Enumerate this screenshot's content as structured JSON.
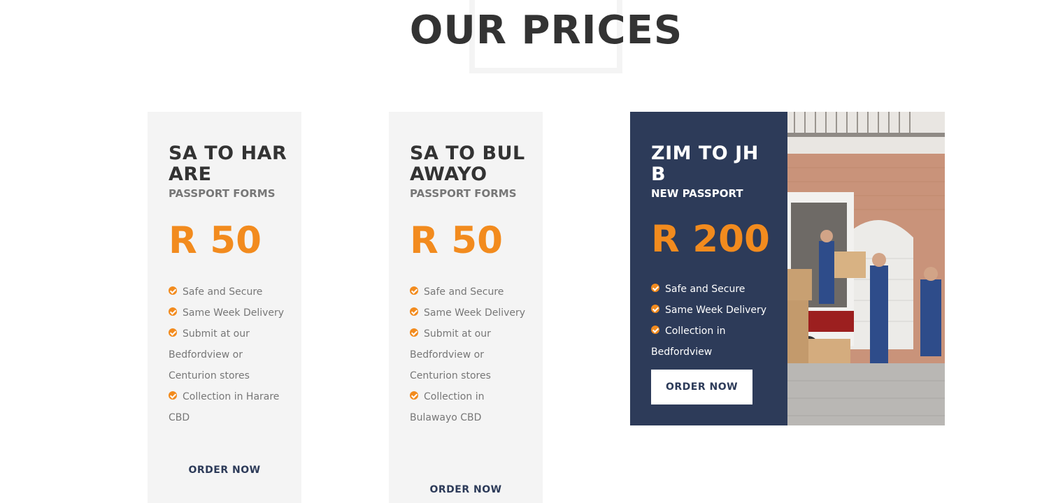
{
  "section": {
    "title": "OUR PRICES"
  },
  "cards": [
    {
      "title": "SA TO HARARE",
      "subtitle": "PASSPORT FORMS",
      "price": "R 50",
      "features": [
        "Safe and Secure",
        "Same Week Delivery",
        "Submit at our Bedfordview or Centurion stores",
        "Collection in Harare CBD"
      ],
      "order_label": "ORDER NOW"
    },
    {
      "title": "SA TO BULAWAYO",
      "subtitle": "PASSPORT FORMS",
      "price": "R 50",
      "features": [
        "Safe and Secure",
        "Same Week Delivery",
        "Submit at our Bedfordview or Centurion stores",
        "Collection in Bulawayo CBD"
      ],
      "order_label": "ORDER NOW"
    },
    {
      "title": "ZIM TO JHB",
      "subtitle": "NEW PASSPORT",
      "price": "R 200",
      "features": [
        "Safe and Secure",
        "Same Week Delivery",
        "Collection in Bedfordview"
      ],
      "order_label": "ORDER NOW"
    }
  ],
  "colors": {
    "accent": "#f28b1e",
    "navy": "#2d3b59",
    "card_bg": "#f4f4f4",
    "heading": "#333333",
    "muted": "#777777"
  },
  "icons": {
    "feature_bullet": "check-circle-icon",
    "photo": "movers-loading-truck-photo"
  }
}
